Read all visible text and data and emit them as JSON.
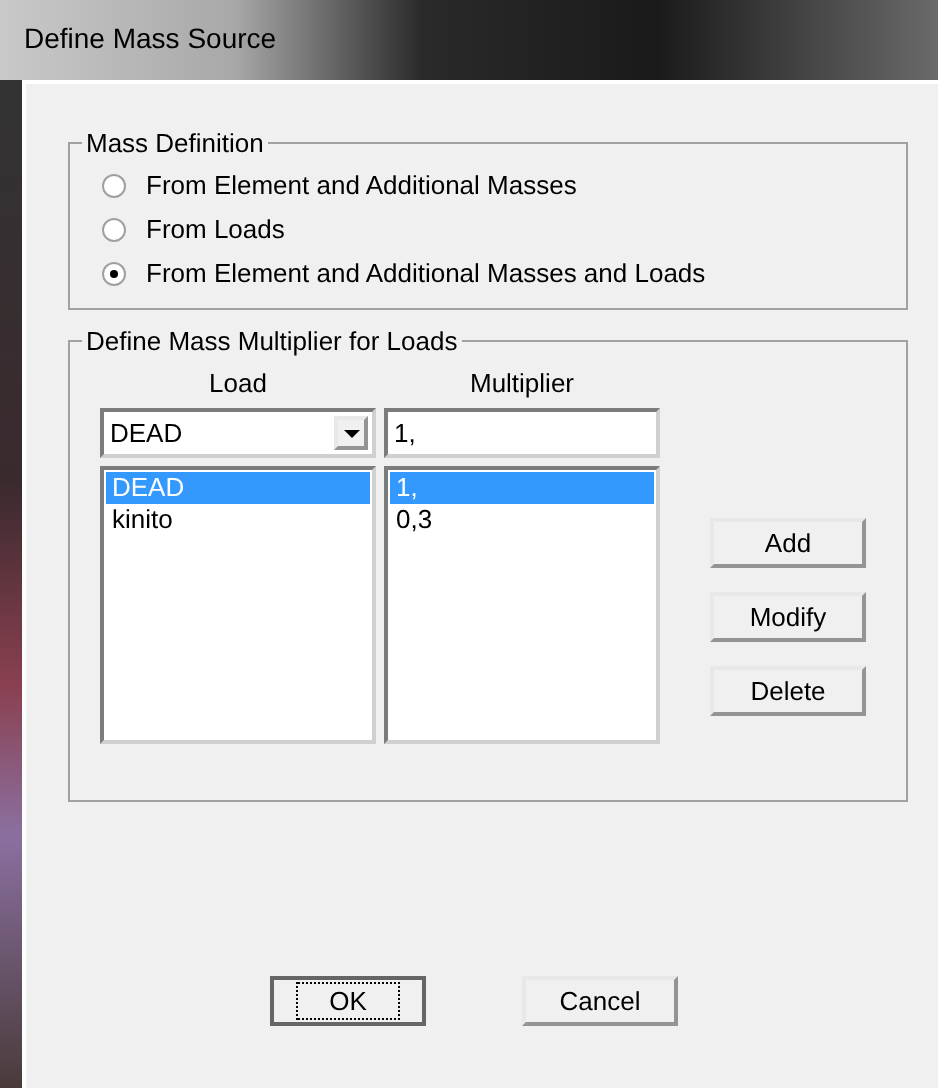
{
  "window": {
    "title": "Define Mass Source"
  },
  "mass_definition": {
    "title": "Mass Definition",
    "options": [
      {
        "label": "From Element and Additional Masses",
        "selected": false
      },
      {
        "label": "From Loads",
        "selected": false
      },
      {
        "label": "From Element and Additional Masses and Loads",
        "selected": true
      }
    ]
  },
  "multiplier": {
    "title": "Define Mass Multiplier for Loads",
    "load_header": "Load",
    "multiplier_header": "Multiplier",
    "load_value": "DEAD",
    "multiplier_value": "1,",
    "rows": [
      {
        "load": "DEAD",
        "multiplier": "1,",
        "selected": true
      },
      {
        "load": "kinito",
        "multiplier": "0,3",
        "selected": false
      }
    ],
    "buttons": [
      "Add",
      "Modify",
      "Delete"
    ]
  },
  "buttons": [
    {
      "label": "OK",
      "focused": true
    },
    {
      "label": "Cancel",
      "focused": false
    }
  ]
}
